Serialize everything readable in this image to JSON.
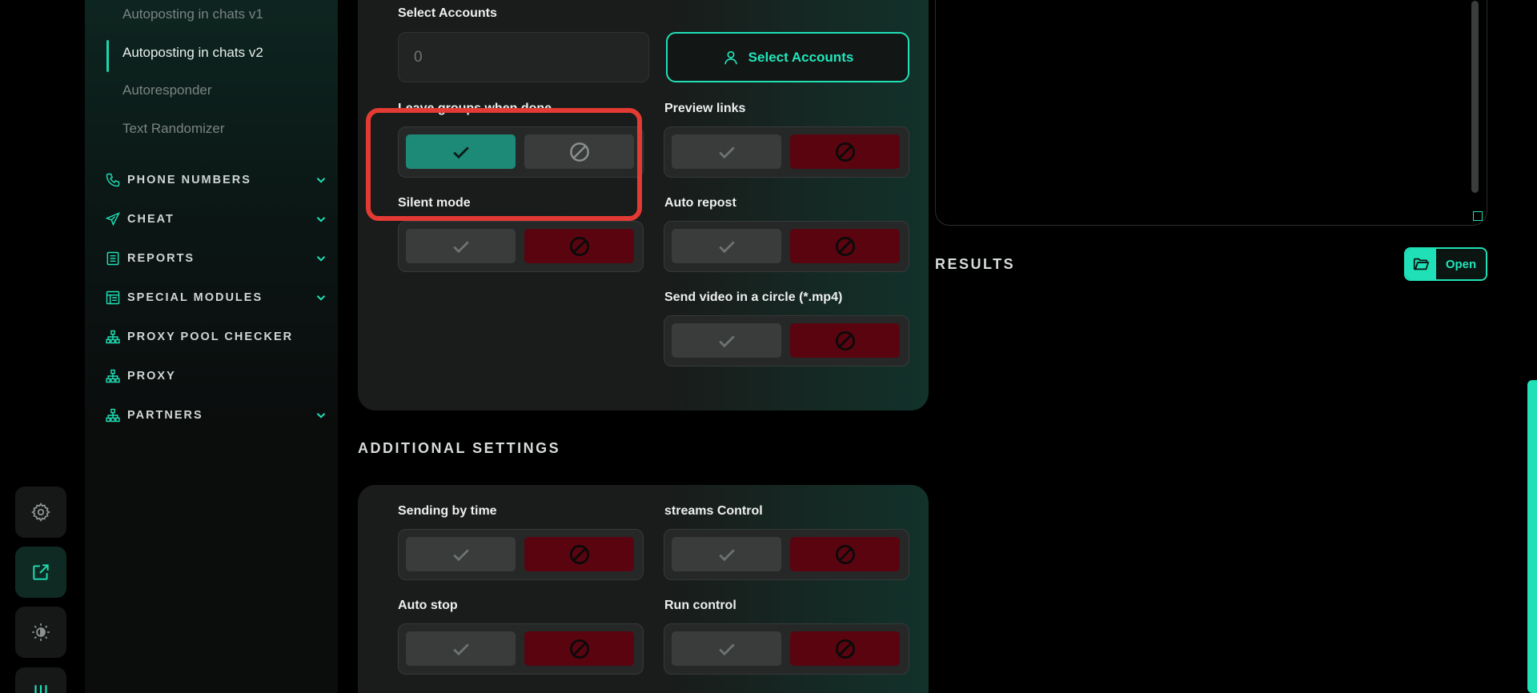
{
  "sidebar": {
    "sub_items": [
      {
        "label": "Autoposting in chats v1",
        "active": false
      },
      {
        "label": "Autoposting in chats v2",
        "active": true
      },
      {
        "label": "Autoresponder",
        "active": false
      },
      {
        "label": "Text Randomizer",
        "active": false
      }
    ],
    "nav_items": [
      {
        "label": "PHONE NUMBERS",
        "icon": "phone-icon",
        "expandable": true
      },
      {
        "label": "CHEAT",
        "icon": "send-icon",
        "expandable": true
      },
      {
        "label": "REPORTS",
        "icon": "list-icon",
        "expandable": true
      },
      {
        "label": "SPECIAL MODULES",
        "icon": "modules-icon",
        "expandable": true
      },
      {
        "label": "PROXY POOL CHECKER",
        "icon": "network-icon",
        "expandable": false
      },
      {
        "label": "PROXY",
        "icon": "network-icon",
        "expandable": false
      },
      {
        "label": "PARTNERS",
        "icon": "network-icon",
        "expandable": true
      }
    ]
  },
  "rail": {
    "buttons": [
      "gear-icon",
      "external-link-icon",
      "theme-icon",
      "sliders-icon"
    ]
  },
  "form": {
    "select_accounts_label": "Select Accounts",
    "accounts_count": "0",
    "select_accounts_button": "Select Accounts",
    "toggles": [
      {
        "label": "Leave groups when done",
        "value": "yes"
      },
      {
        "label": "Preview links",
        "value": "no"
      },
      {
        "label": "Silent mode",
        "value": "no"
      },
      {
        "label": "Auto repost",
        "value": "no"
      },
      {
        "label": "Send video in a circle (*.mp4)",
        "value": "no"
      }
    ]
  },
  "additional": {
    "title": "ADDITIONAL SETTINGS",
    "toggles": [
      {
        "label": "Sending by time",
        "value": "no"
      },
      {
        "label": "streams Control",
        "value": "no"
      },
      {
        "label": "Auto stop",
        "value": "no"
      },
      {
        "label": "Run control",
        "value": "no"
      }
    ]
  },
  "results": {
    "title": "RESULTS",
    "open_button": "Open"
  },
  "colors": {
    "accent": "#1fe0b6",
    "on_green": "#1d8a78",
    "off_red": "#5a0410",
    "highlight": "#e33a33"
  }
}
